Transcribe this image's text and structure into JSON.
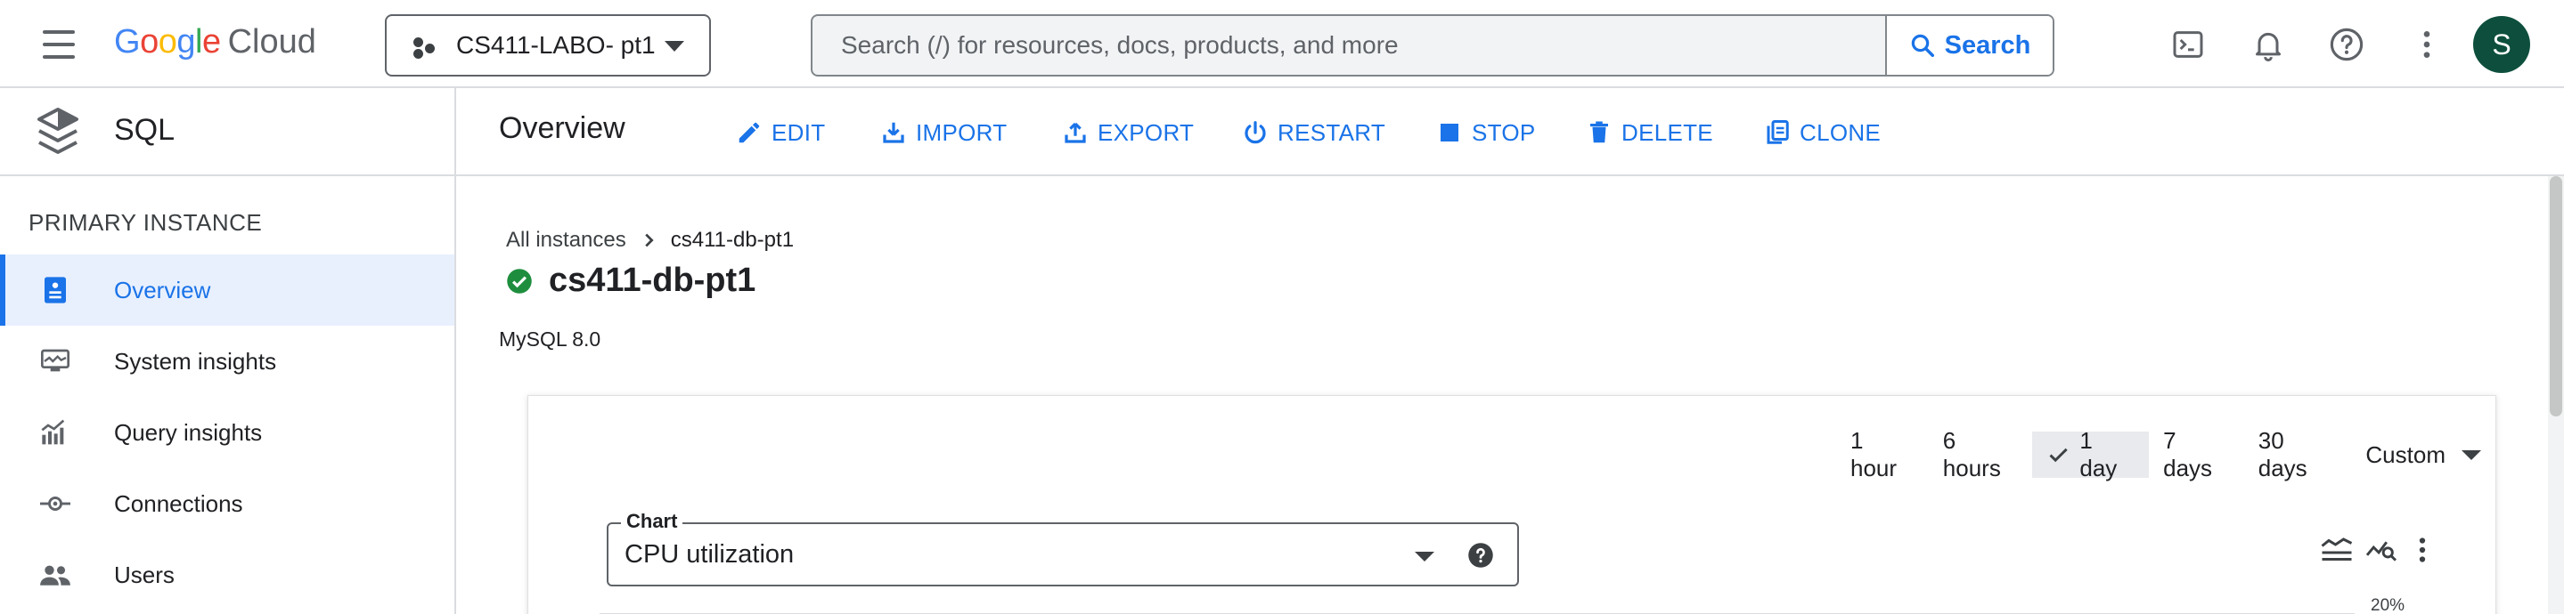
{
  "header": {
    "logo": {
      "google_letters": [
        "G",
        "o",
        "o",
        "g",
        "l",
        "e"
      ],
      "cloud": "Cloud",
      "colors": [
        "#4285F4",
        "#EA4335",
        "#FBBC05",
        "#4285F4",
        "#34A853",
        "#EA4335"
      ]
    },
    "project": "CS411-LABO- pt1",
    "search": {
      "placeholder": "Search (/) for resources, docs, products, and more",
      "button": "Search"
    },
    "icons": [
      "cloud-shell-icon",
      "notifications-icon",
      "help-icon",
      "more-vert-icon"
    ],
    "avatar_initial": "S"
  },
  "sidebar": {
    "product": "SQL",
    "section": "PRIMARY INSTANCE",
    "items": [
      {
        "label": "Overview",
        "icon": "overview-icon",
        "active": true
      },
      {
        "label": "System insights",
        "icon": "system-insights-icon"
      },
      {
        "label": "Query insights",
        "icon": "query-insights-icon"
      },
      {
        "label": "Connections",
        "icon": "connections-icon"
      },
      {
        "label": "Users",
        "icon": "users-icon"
      }
    ]
  },
  "actionbar": {
    "title": "Overview",
    "actions": [
      "EDIT",
      "IMPORT",
      "EXPORT",
      "RESTART",
      "STOP",
      "DELETE",
      "CLONE"
    ]
  },
  "main": {
    "breadcrumb": {
      "parent": "All instances",
      "current": "cs411-db-pt1"
    },
    "instance_name": "cs411-db-pt1",
    "version": "MySQL 8.0",
    "time_ranges": [
      "1 hour",
      "6 hours",
      "1 day",
      "7 days",
      "30 days",
      "Custom"
    ],
    "selected_range": "1 day",
    "chart_select": {
      "label": "Chart",
      "value": "CPU utilization"
    },
    "y_tick_top": "20%"
  },
  "colors": {
    "accent": "#1a73e8",
    "success": "#1e8e3e",
    "avatar": "#0d4f3c"
  }
}
